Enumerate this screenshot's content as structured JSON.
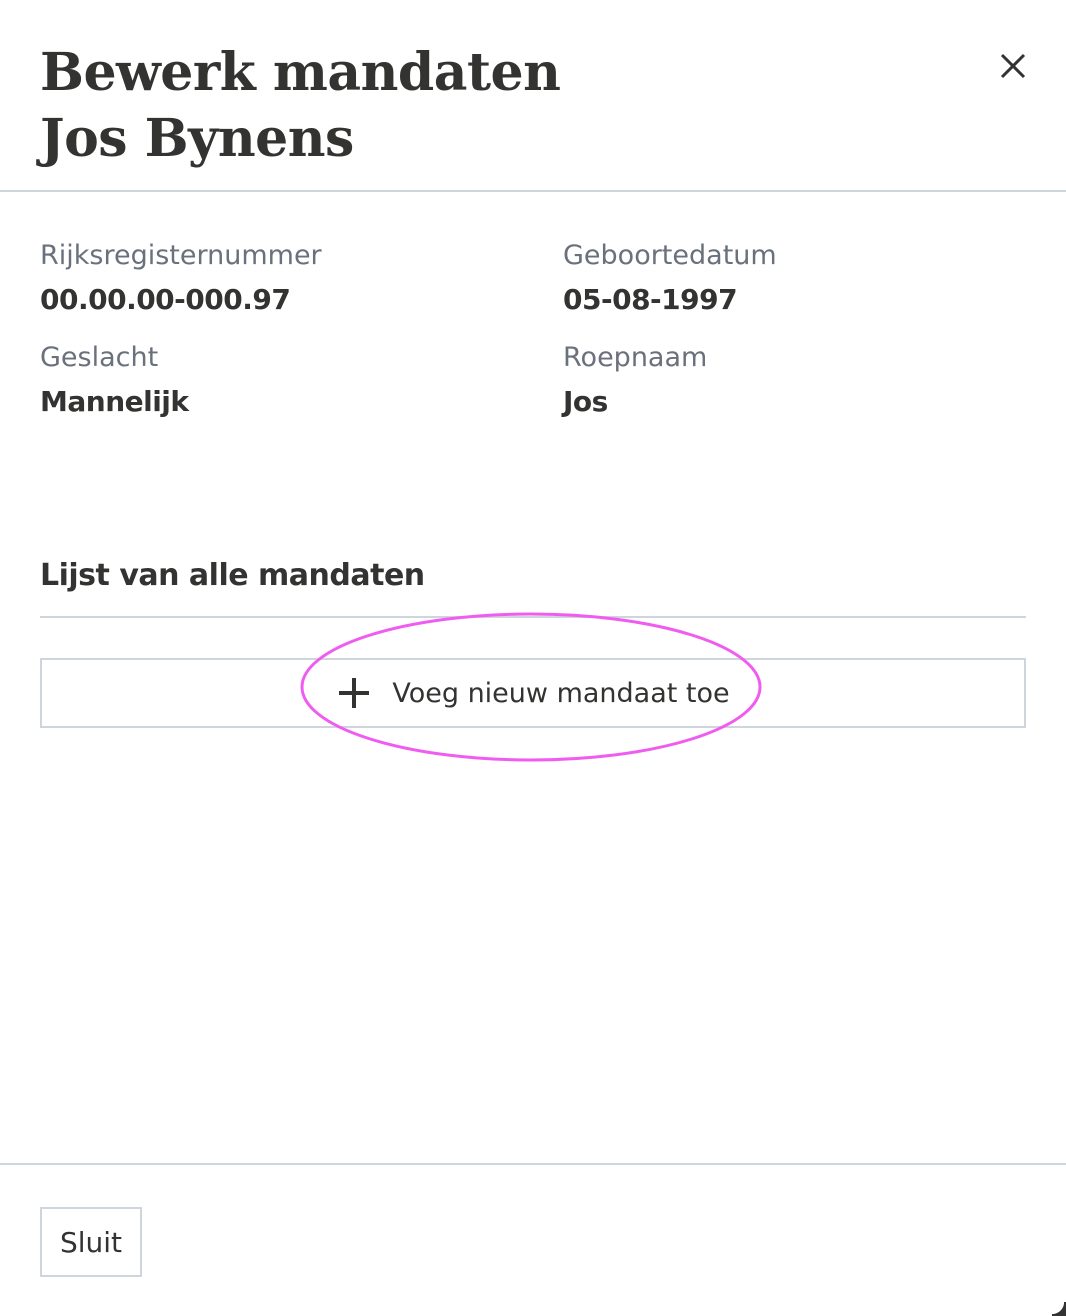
{
  "header": {
    "title_line1": "Bewerk mandaten",
    "title_line2": "Jos Bynens",
    "close_icon": "close-icon"
  },
  "person": {
    "fields": [
      {
        "label": "Rijksregisternummer",
        "value": "00.00.00-000.97"
      },
      {
        "label": "Geboortedatum",
        "value": "05-08-1997"
      },
      {
        "label": "Geslacht",
        "value": "Mannelijk"
      },
      {
        "label": "Roepnaam",
        "value": "Jos"
      }
    ]
  },
  "mandates": {
    "section_title": "Lijst van alle mandaten",
    "add_button_label": "Voeg nieuw mandaat toe",
    "add_icon": "plus-icon"
  },
  "footer": {
    "close_label": "Sluit"
  },
  "colors": {
    "text": "#333332",
    "label": "#69717c",
    "border": "#cfd5dd",
    "highlight": "#f05cf0"
  }
}
